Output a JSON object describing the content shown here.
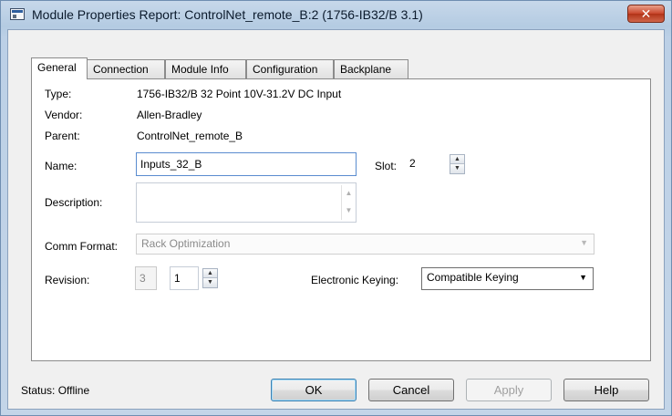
{
  "window": {
    "title": "Module Properties Report: ControlNet_remote_B:2 (1756-IB32/B 3.1)",
    "close_glyph": "✕"
  },
  "tabs": [
    {
      "label": "General",
      "active": true
    },
    {
      "label": "Connection",
      "active": false
    },
    {
      "label": "Module Info",
      "active": false
    },
    {
      "label": "Configuration",
      "active": false
    },
    {
      "label": "Backplane",
      "active": false
    }
  ],
  "general": {
    "type_label": "Type:",
    "type_value": "1756-IB32/B 32 Point 10V-31.2V DC Input",
    "vendor_label": "Vendor:",
    "vendor_value": "Allen-Bradley",
    "parent_label": "Parent:",
    "parent_value": "ControlNet_remote_B",
    "name_label": "Name:",
    "name_value": "Inputs_32_B",
    "slot_label": "Slot:",
    "slot_value": "2",
    "description_label": "Description:",
    "description_value": "",
    "comm_format_label": "Comm Format:",
    "comm_format_value": "Rack Optimization",
    "revision_label": "Revision:",
    "revision_major": "3",
    "revision_minor": "1",
    "keying_label": "Electronic Keying:",
    "keying_value": "Compatible Keying"
  },
  "footer": {
    "status": "Status:  Offline",
    "ok": "OK",
    "cancel": "Cancel",
    "apply": "Apply",
    "help": "Help"
  },
  "icons": {
    "spin_up": "▲",
    "spin_down": "▼",
    "dropdown": "▼"
  }
}
